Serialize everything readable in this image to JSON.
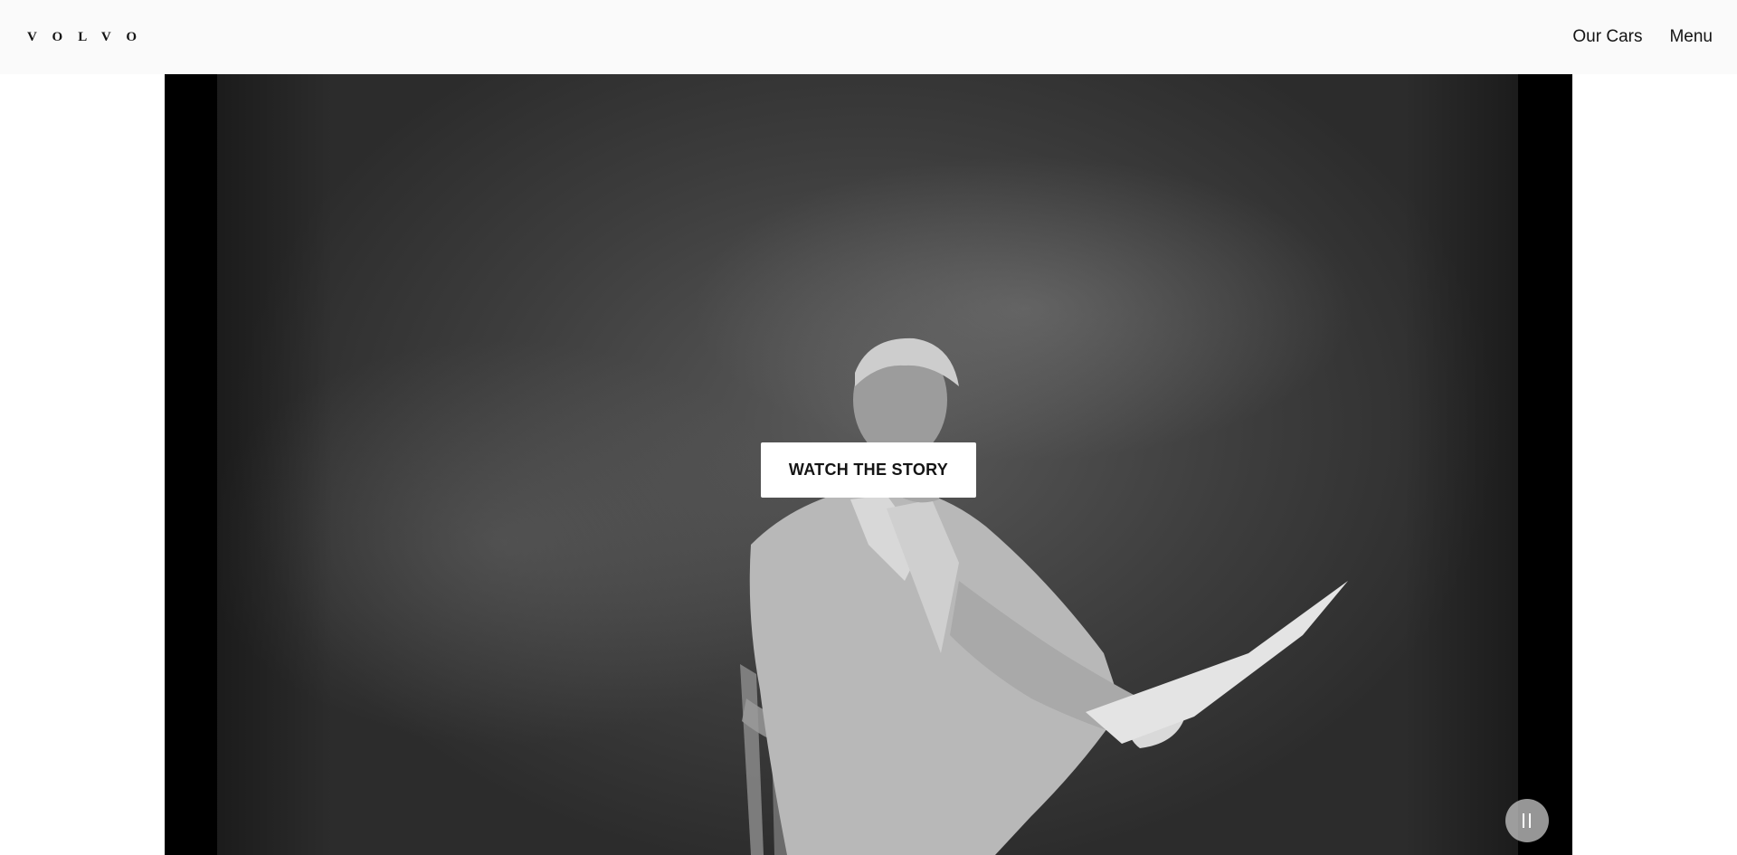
{
  "header": {
    "logo_text": "VOLVO",
    "nav": {
      "our_cars_label": "Our Cars",
      "menu_label": "Menu"
    }
  },
  "hero": {
    "media_description": "Black-and-white film still",
    "cta_label": "WATCH THE STORY",
    "pause_icon": "pause-icon"
  },
  "colors": {
    "header_bg": "#fafafa",
    "text": "#141414",
    "button_bg": "#ffffff"
  }
}
